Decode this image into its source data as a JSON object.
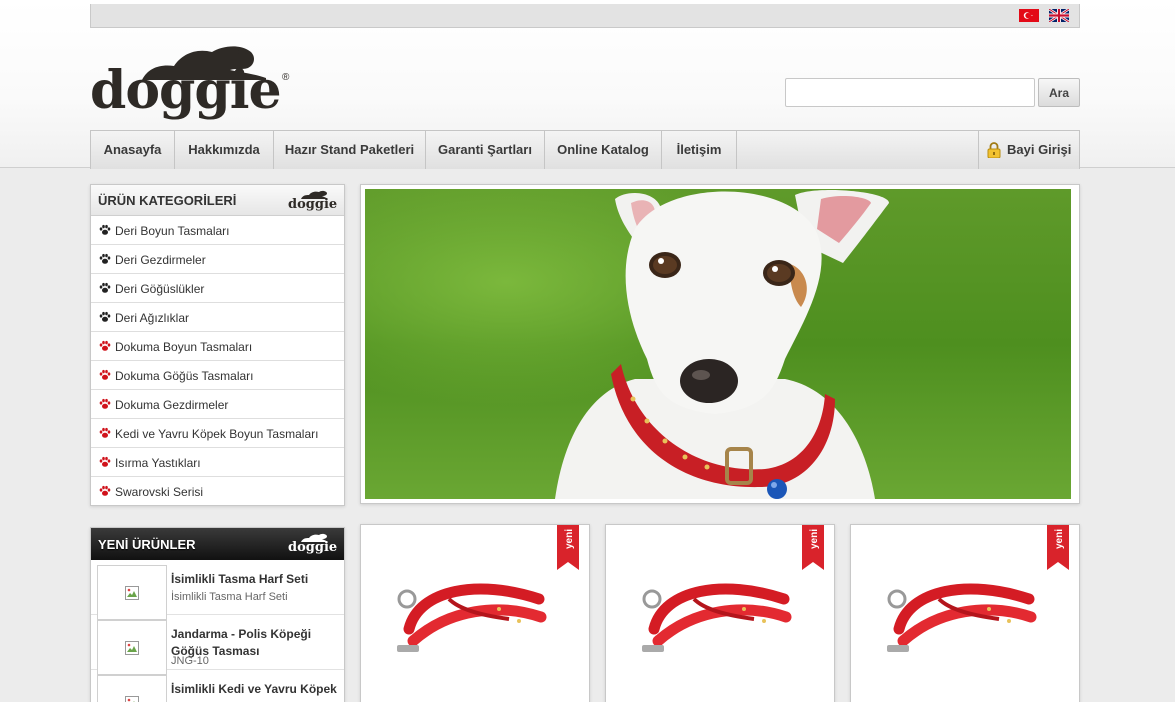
{
  "brand": {
    "logo_text": "doggie",
    "registered": "®"
  },
  "language_flags": [
    {
      "icon": "turkey-flag-icon",
      "color": "#e30a17"
    },
    {
      "icon": "uk-flag-icon",
      "color": "#012169"
    }
  ],
  "search": {
    "value": "",
    "placeholder": "",
    "button_label": "Ara"
  },
  "nav": {
    "items": [
      {
        "label": "Anasayfa"
      },
      {
        "label": "Hakkımızda"
      },
      {
        "label": "Hazır Stand Paketleri"
      },
      {
        "label": "Garanti Şartları"
      },
      {
        "label": "Online Katalog"
      },
      {
        "label": "İletişim"
      }
    ],
    "login_label": "Bayi Girişi",
    "login_icon": "lock-icon"
  },
  "categories": {
    "title": "ÜRÜN KATEGORİLERİ",
    "items": [
      {
        "label": "Deri Boyun Tasmaları",
        "paw_color": "#222222"
      },
      {
        "label": "Deri Gezdirmeler",
        "paw_color": "#222222"
      },
      {
        "label": "Deri Göğüslükler",
        "paw_color": "#222222"
      },
      {
        "label": "Deri Ağızlıklar",
        "paw_color": "#222222"
      },
      {
        "label": "Dokuma Boyun Tasmaları",
        "paw_color": "#d0121b"
      },
      {
        "label": "Dokuma Göğüs Tasmaları",
        "paw_color": "#d0121b"
      },
      {
        "label": "Dokuma Gezdirmeler",
        "paw_color": "#d0121b"
      },
      {
        "label": "Kedi ve Yavru Köpek Boyun Tasmaları",
        "paw_color": "#d0121b"
      },
      {
        "label": "Isırma Yastıkları",
        "paw_color": "#d0121b"
      },
      {
        "label": "Swarovski Serisi",
        "paw_color": "#d0121b"
      }
    ]
  },
  "new_products": {
    "title": "YENİ ÜRÜNLER",
    "items": [
      {
        "name": "İsimlikli Tasma Harf Seti",
        "code": "İsimlikli Tasma Harf Seti"
      },
      {
        "name": "Jandarma - Polis Köpeği Göğüs Tasması",
        "code": "JNG-10"
      },
      {
        "name": "İsimlikli Kedi ve Yavru Köpek",
        "code": ""
      }
    ]
  },
  "product_cards": [
    {
      "ribbon": "yeni",
      "caption": ""
    },
    {
      "ribbon": "yeni",
      "caption": ""
    },
    {
      "ribbon": "yeni",
      "caption": ""
    }
  ],
  "colors": {
    "accent_red": "#d0121b",
    "ribbon_red": "#d9232b",
    "dark_logo": "#2e2a26"
  }
}
